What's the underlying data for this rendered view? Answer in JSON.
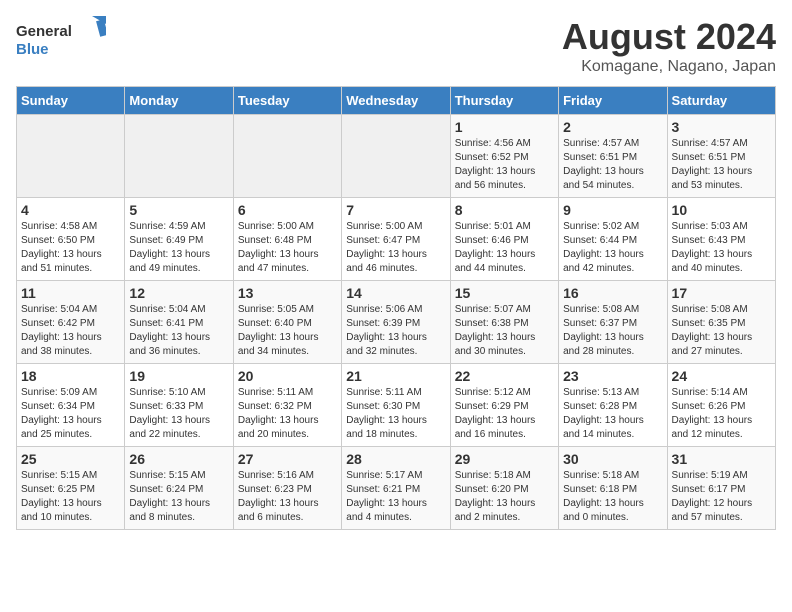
{
  "logo": {
    "line1": "General",
    "line2": "Blue"
  },
  "title": "August 2024",
  "subtitle": "Komagane, Nagano, Japan",
  "weekdays": [
    "Sunday",
    "Monday",
    "Tuesday",
    "Wednesday",
    "Thursday",
    "Friday",
    "Saturday"
  ],
  "weeks": [
    [
      {
        "day": "",
        "info": ""
      },
      {
        "day": "",
        "info": ""
      },
      {
        "day": "",
        "info": ""
      },
      {
        "day": "",
        "info": ""
      },
      {
        "day": "1",
        "info": "Sunrise: 4:56 AM\nSunset: 6:52 PM\nDaylight: 13 hours\nand 56 minutes."
      },
      {
        "day": "2",
        "info": "Sunrise: 4:57 AM\nSunset: 6:51 PM\nDaylight: 13 hours\nand 54 minutes."
      },
      {
        "day": "3",
        "info": "Sunrise: 4:57 AM\nSunset: 6:51 PM\nDaylight: 13 hours\nand 53 minutes."
      }
    ],
    [
      {
        "day": "4",
        "info": "Sunrise: 4:58 AM\nSunset: 6:50 PM\nDaylight: 13 hours\nand 51 minutes."
      },
      {
        "day": "5",
        "info": "Sunrise: 4:59 AM\nSunset: 6:49 PM\nDaylight: 13 hours\nand 49 minutes."
      },
      {
        "day": "6",
        "info": "Sunrise: 5:00 AM\nSunset: 6:48 PM\nDaylight: 13 hours\nand 47 minutes."
      },
      {
        "day": "7",
        "info": "Sunrise: 5:00 AM\nSunset: 6:47 PM\nDaylight: 13 hours\nand 46 minutes."
      },
      {
        "day": "8",
        "info": "Sunrise: 5:01 AM\nSunset: 6:46 PM\nDaylight: 13 hours\nand 44 minutes."
      },
      {
        "day": "9",
        "info": "Sunrise: 5:02 AM\nSunset: 6:44 PM\nDaylight: 13 hours\nand 42 minutes."
      },
      {
        "day": "10",
        "info": "Sunrise: 5:03 AM\nSunset: 6:43 PM\nDaylight: 13 hours\nand 40 minutes."
      }
    ],
    [
      {
        "day": "11",
        "info": "Sunrise: 5:04 AM\nSunset: 6:42 PM\nDaylight: 13 hours\nand 38 minutes."
      },
      {
        "day": "12",
        "info": "Sunrise: 5:04 AM\nSunset: 6:41 PM\nDaylight: 13 hours\nand 36 minutes."
      },
      {
        "day": "13",
        "info": "Sunrise: 5:05 AM\nSunset: 6:40 PM\nDaylight: 13 hours\nand 34 minutes."
      },
      {
        "day": "14",
        "info": "Sunrise: 5:06 AM\nSunset: 6:39 PM\nDaylight: 13 hours\nand 32 minutes."
      },
      {
        "day": "15",
        "info": "Sunrise: 5:07 AM\nSunset: 6:38 PM\nDaylight: 13 hours\nand 30 minutes."
      },
      {
        "day": "16",
        "info": "Sunrise: 5:08 AM\nSunset: 6:37 PM\nDaylight: 13 hours\nand 28 minutes."
      },
      {
        "day": "17",
        "info": "Sunrise: 5:08 AM\nSunset: 6:35 PM\nDaylight: 13 hours\nand 27 minutes."
      }
    ],
    [
      {
        "day": "18",
        "info": "Sunrise: 5:09 AM\nSunset: 6:34 PM\nDaylight: 13 hours\nand 25 minutes."
      },
      {
        "day": "19",
        "info": "Sunrise: 5:10 AM\nSunset: 6:33 PM\nDaylight: 13 hours\nand 22 minutes."
      },
      {
        "day": "20",
        "info": "Sunrise: 5:11 AM\nSunset: 6:32 PM\nDaylight: 13 hours\nand 20 minutes."
      },
      {
        "day": "21",
        "info": "Sunrise: 5:11 AM\nSunset: 6:30 PM\nDaylight: 13 hours\nand 18 minutes."
      },
      {
        "day": "22",
        "info": "Sunrise: 5:12 AM\nSunset: 6:29 PM\nDaylight: 13 hours\nand 16 minutes."
      },
      {
        "day": "23",
        "info": "Sunrise: 5:13 AM\nSunset: 6:28 PM\nDaylight: 13 hours\nand 14 minutes."
      },
      {
        "day": "24",
        "info": "Sunrise: 5:14 AM\nSunset: 6:26 PM\nDaylight: 13 hours\nand 12 minutes."
      }
    ],
    [
      {
        "day": "25",
        "info": "Sunrise: 5:15 AM\nSunset: 6:25 PM\nDaylight: 13 hours\nand 10 minutes."
      },
      {
        "day": "26",
        "info": "Sunrise: 5:15 AM\nSunset: 6:24 PM\nDaylight: 13 hours\nand 8 minutes."
      },
      {
        "day": "27",
        "info": "Sunrise: 5:16 AM\nSunset: 6:23 PM\nDaylight: 13 hours\nand 6 minutes."
      },
      {
        "day": "28",
        "info": "Sunrise: 5:17 AM\nSunset: 6:21 PM\nDaylight: 13 hours\nand 4 minutes."
      },
      {
        "day": "29",
        "info": "Sunrise: 5:18 AM\nSunset: 6:20 PM\nDaylight: 13 hours\nand 2 minutes."
      },
      {
        "day": "30",
        "info": "Sunrise: 5:18 AM\nSunset: 6:18 PM\nDaylight: 13 hours\nand 0 minutes."
      },
      {
        "day": "31",
        "info": "Sunrise: 5:19 AM\nSunset: 6:17 PM\nDaylight: 12 hours\nand 57 minutes."
      }
    ]
  ]
}
